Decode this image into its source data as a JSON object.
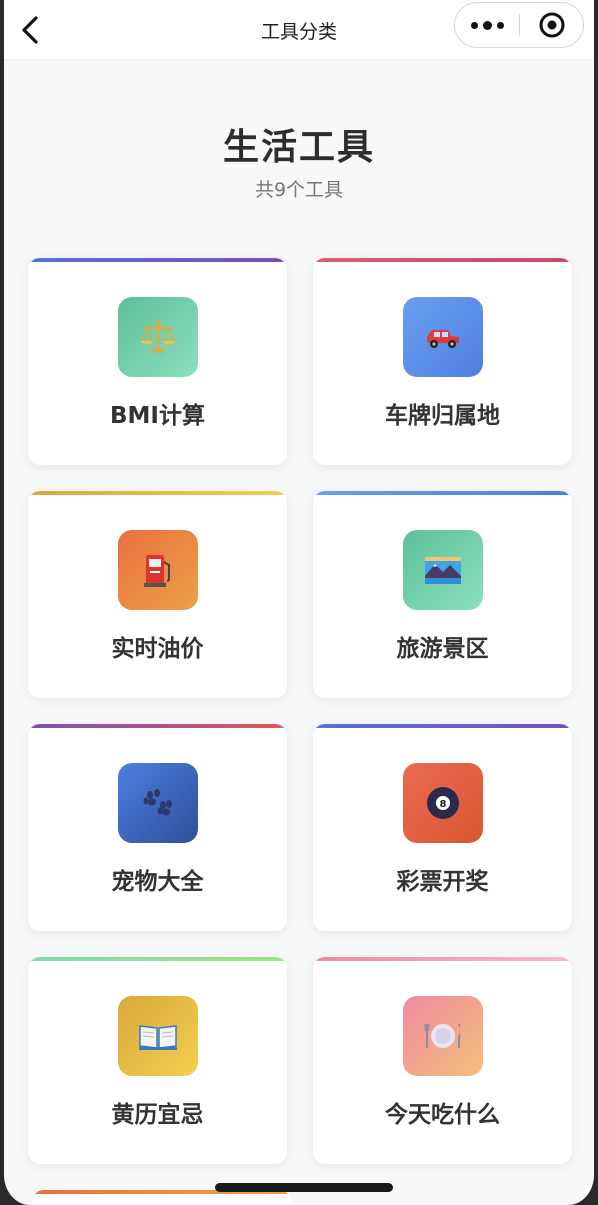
{
  "nav": {
    "title": "工具分类"
  },
  "header": {
    "title": "生活工具",
    "subtitle": "共9个工具"
  },
  "tools": [
    {
      "label": "BMI计算",
      "icon": "scale-icon",
      "bar": "linear-gradient(90deg,#5b6fd6,#7a4fb5)",
      "bg": "linear-gradient(135deg,#5fbf9a,#8be0be)"
    },
    {
      "label": "车牌归属地",
      "icon": "car-icon",
      "bar": "linear-gradient(90deg,#e05a7a,#c44a6a)",
      "bg": "linear-gradient(135deg,#6aa0ef,#4f7fe0)"
    },
    {
      "label": "实时油价",
      "icon": "fuel-pump-icon",
      "bar": "linear-gradient(90deg,#d8a83a,#f2d050)",
      "bg": "linear-gradient(135deg,#ec6f3f,#e9a14a)"
    },
    {
      "label": "旅游景区",
      "icon": "landscape-icon",
      "bar": "linear-gradient(90deg,#6a9ef0,#4d7fe0)",
      "bg": "linear-gradient(135deg,#5fbf9a,#8be0be)"
    },
    {
      "label": "宠物大全",
      "icon": "paw-icon",
      "bar": "linear-gradient(90deg,#7b4fb5,#e05a5a)",
      "bg": "linear-gradient(135deg,#4e7fe0,#2f4f9a)"
    },
    {
      "label": "彩票开奖",
      "icon": "billiard-ball-icon",
      "bar": "linear-gradient(90deg,#5b6fd6,#7a4fb5)",
      "bg": "linear-gradient(135deg,#ea6a55,#d9572e)"
    },
    {
      "label": "黄历宜忌",
      "icon": "open-book-icon",
      "bar": "linear-gradient(90deg,#7fdcb0,#a0e090)",
      "bg": "linear-gradient(135deg,#d8a83a,#f2d050)"
    },
    {
      "label": "今天吃什么",
      "icon": "plate-icon",
      "bar": "linear-gradient(90deg,#f08aa0,#f7b8d0)",
      "bg": "linear-gradient(135deg,#ef8aa0,#f2c07a)"
    }
  ]
}
